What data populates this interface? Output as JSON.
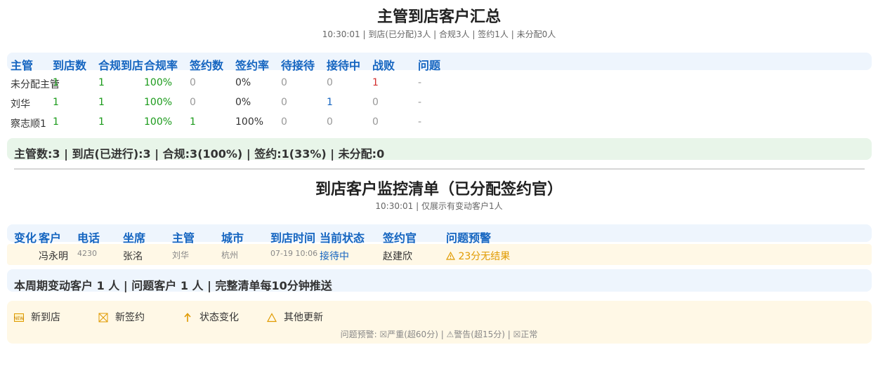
{
  "summary_section": {
    "title": "主管到店客户汇总",
    "subtitle": "10:30:01 | 到店(已分配)3人 | 合规3人 | 签约1人 | 未分配0人",
    "headers": [
      "主管",
      "到店数",
      "合规到店",
      "合规率",
      "签约数",
      "签约率",
      "待接待",
      "接待中",
      "战败",
      "问题"
    ],
    "rows": [
      {
        "name": "未分配主管",
        "arrive": "1",
        "compliant": "1",
        "rate": "100%",
        "signed": "0",
        "sign_rate": "0%",
        "waiting": "0",
        "receiving": "0",
        "lost": "1",
        "issue": "-"
      },
      {
        "name": "刘华",
        "arrive": "1",
        "compliant": "1",
        "rate": "100%",
        "signed": "0",
        "sign_rate": "0%",
        "waiting": "0",
        "receiving": "1",
        "lost": "0",
        "issue": "-"
      },
      {
        "name": "察志顺1",
        "arrive": "1",
        "compliant": "1",
        "rate": "100%",
        "signed": "1",
        "sign_rate": "100%",
        "waiting": "0",
        "receiving": "0",
        "lost": "0",
        "issue": "-"
      }
    ],
    "totals": "主管数:3 | 到店(已进行):3 | 合规:3(100%) | 签约:1(33%) | 未分配:0"
  },
  "monitor_section": {
    "title": "到店客户监控清单（已分配签约官）",
    "subtitle": "10:30:01 | 仅展示有变动客户1人",
    "headers": [
      "变化",
      "客户",
      "电话",
      "坐席",
      "主管",
      "城市",
      "到店时间",
      "当前状态",
      "签约官",
      "问题预警"
    ],
    "rows": [
      {
        "change": "",
        "customer": "冯永明",
        "phone": "4230",
        "agent": "张洺",
        "manager": "刘华",
        "city": "杭州",
        "time": "07-19 10:06",
        "status": "接待中",
        "officer": "赵建欣",
        "warning": "23分无结果",
        "warning_icon": "warning-icon"
      }
    ],
    "footer": "本周期变动客户 1 人 | 问题客户 1 人 | 完整清单每10分钟推送"
  },
  "legend": {
    "items": [
      {
        "label": "新到店",
        "icon": "new-icon"
      },
      {
        "label": "新签约",
        "icon": "sign-icon"
      },
      {
        "label": "状态变化",
        "icon": "arrow-up-icon"
      },
      {
        "label": "其他更新",
        "icon": "triangle-icon"
      }
    ],
    "note": "问题预警: ☒严重(超60分) | ⚠警告(超15分) | ☒正常"
  },
  "colors": {
    "header_band": "#eef5fd",
    "summary_band": "#e8f5e9",
    "highlight_row": "#fff8e6",
    "legend_band": "#fff8e6",
    "accent_blue": "#1565c0",
    "green": "#1a9a1a",
    "warning": "#e09a00"
  }
}
